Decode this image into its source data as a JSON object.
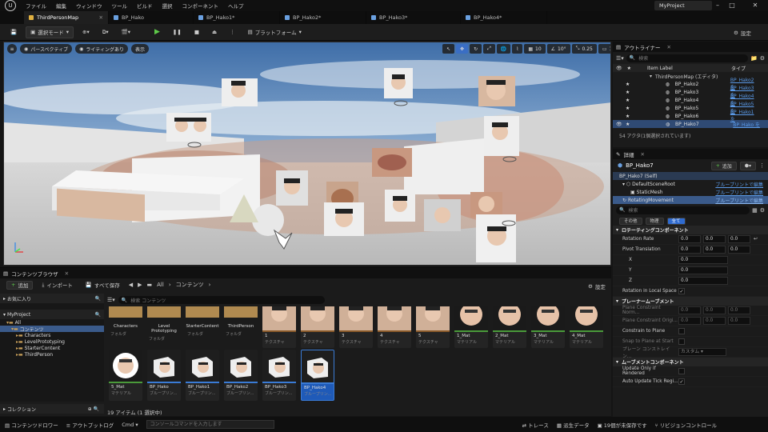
{
  "menu": {
    "items": [
      "ファイル",
      "編集",
      "ウィンドウ",
      "ツール",
      "ビルド",
      "選択",
      "コンポーネント",
      "ヘルプ"
    ],
    "project_name": "MyProject"
  },
  "tabs": [
    {
      "label": "ThirdPersonMap",
      "active": true
    },
    {
      "label": "BP_Hako"
    },
    {
      "label": "BP_Hako1*"
    },
    {
      "label": "BP_Hako2*"
    },
    {
      "label": "BP_Hako3*"
    },
    {
      "label": "BP_Hako4*"
    }
  ],
  "toolbar": {
    "select_mode": "選択モード",
    "platforms": "プラットフォーム",
    "settings": "設定"
  },
  "viewport": {
    "perspective": "パースペクティブ",
    "lighting": "ライティングあり",
    "show": "表示",
    "grid_snap": "10",
    "rot_snap": "10°",
    "scale_snap": "0.25",
    "camera_speed": "1"
  },
  "outliner": {
    "title": "アウトライナー",
    "search_placeholder": "検索",
    "col_label": "Item Label",
    "col_type": "タイプ",
    "root": "ThirdPersonMap (エディタ)",
    "rows": [
      {
        "label": "BP_Hako2",
        "type": "BP_Hako2 を"
      },
      {
        "label": "BP_Hako3",
        "type": "BP_Hako3 を"
      },
      {
        "label": "BP_Hako4",
        "type": "BP_Hako4 を"
      },
      {
        "label": "BP_Hako5",
        "type": "BP_Hako5 を"
      },
      {
        "label": "BP_Hako6",
        "type": "BP_Hako1 を"
      },
      {
        "label": "BP_Hako7",
        "type": "BP_Hako を",
        "selected": true
      }
    ],
    "footer": "54 アクタ(1個選択されています)"
  },
  "details": {
    "title": "詳細",
    "actor": "BP_Hako7",
    "add": "追加",
    "self": "BP_Hako7 (Self)",
    "components": [
      {
        "name": "DefaultSceneRoot",
        "link": "ブループリントで編集"
      },
      {
        "name": "StaticMesh",
        "link": "ブループリントで編集"
      },
      {
        "name": "RotatingMovement",
        "link": "ブループリントで編集"
      }
    ],
    "search_placeholder": "検索",
    "filters": [
      "その他",
      "物理",
      "全て"
    ],
    "sections": {
      "rotating": "ロテーティングコンポーネント",
      "planar": "プレーナームーブメント",
      "movement": "ムーブメントコンポーネント"
    },
    "rotation_rate": {
      "label": "Rotation Rate",
      "x": "0.0",
      "y": "0.0",
      "z": "0.0"
    },
    "pivot_translation": {
      "label": "Pivot Translation",
      "x": "0.0",
      "y": "0.0",
      "z": "0.0"
    },
    "pivot_x": {
      "label": "X",
      "value": "0.0"
    },
    "pivot_y": {
      "label": "Y",
      "value": "0.0"
    },
    "pivot_z": {
      "label": "Z",
      "value": "0.0"
    },
    "rotation_local": "Rotation in Local Space",
    "plane_normal": {
      "label": "Plane Constraint Norm...",
      "x": "0.0",
      "y": "0.0",
      "z": "0.0"
    },
    "plane_origin": {
      "label": "Plane Constraint Origi...",
      "x": "0.0",
      "y": "0.0",
      "z": "0.0"
    },
    "constrain_plane": "Constrain to Plane",
    "snap_plane": "Snap to Plane at Start",
    "plane_axis": {
      "label": "プレーン コンストレイン...",
      "value": "カスタム"
    },
    "update_rendered": "Update Only if Rendered",
    "update_tick": "Auto Update Tick Regi..."
  },
  "content_browser": {
    "title": "コンテンツブラウザ",
    "add": "追加",
    "import": "インポート",
    "save_all": "すべて保存",
    "path": [
      "All",
      "コンテンツ"
    ],
    "settings": "設定",
    "favorites": "お気に入り",
    "project": "MyProject",
    "tree": [
      "All",
      "コンテンツ",
      "Characters",
      "LevelPrototyping",
      "StarterContent",
      "ThirdPerson"
    ],
    "search_placeholder": "検索 コンテンツ",
    "folders": [
      {
        "name": "Characters",
        "type": "フォルダ"
      },
      {
        "name": "Level Prototyping",
        "type": "フォルダ"
      },
      {
        "name": "StarterContent",
        "type": "フォルダ"
      },
      {
        "name": "ThirdPerson",
        "type": "フォルダ"
      }
    ],
    "textures": [
      {
        "name": "1",
        "type": "テクスチャ"
      },
      {
        "name": "2",
        "type": "テクスチャ"
      },
      {
        "name": "3",
        "type": "テクスチャ"
      },
      {
        "name": "4",
        "type": "テクスチャ"
      },
      {
        "name": "5",
        "type": "テクスチャ"
      }
    ],
    "materials": [
      {
        "name": "1_Mat",
        "type": "マテリアル"
      },
      {
        "name": "2_Mat",
        "type": "マテリアル"
      },
      {
        "name": "3_Mat",
        "type": "マテリアル"
      },
      {
        "name": "4_Mat",
        "type": "マテリアル"
      }
    ],
    "row2": [
      {
        "name": "5_Mat",
        "type": "マテリアル"
      },
      {
        "name": "BP_Hako",
        "type": "ブループリン..."
      },
      {
        "name": "BP_Hako1",
        "type": "ブループリン..."
      },
      {
        "name": "BP_Hako2",
        "type": "ブループリン..."
      },
      {
        "name": "BP_Hako3",
        "type": "ブループリン..."
      },
      {
        "name": "BP_Hako4",
        "type": "ブループリン..."
      }
    ],
    "count": "19 アイテム (1 選択中)",
    "collections": "コレクション"
  },
  "statusbar": {
    "drawer": "コンテンツドロワー",
    "output_log": "アウトプットログ",
    "cmd": "Cmd",
    "cmd_placeholder": "コンソールコマンドを入力します",
    "trace": "トレース",
    "derived": "派生データ",
    "unsaved": "19個が未保存です",
    "revision": "リビジョンコントロール"
  }
}
